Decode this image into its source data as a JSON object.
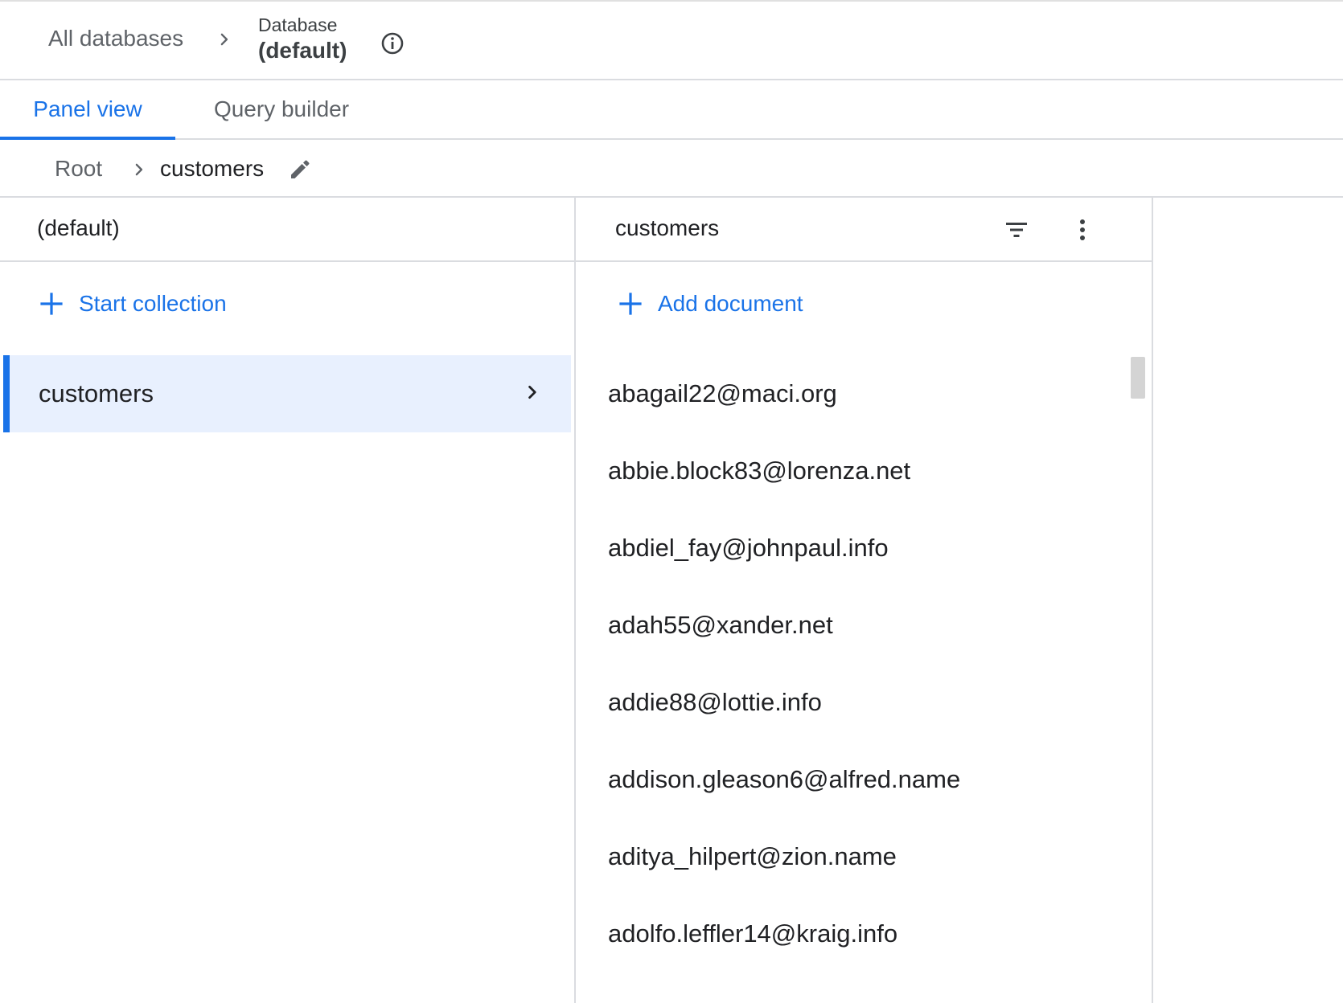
{
  "header": {
    "all_databases": "All databases",
    "database_label": "Database",
    "database_name": "(default)"
  },
  "tabs": [
    {
      "label": "Panel view",
      "active": true
    },
    {
      "label": "Query builder",
      "active": false
    }
  ],
  "path": {
    "root": "Root",
    "current": "customers"
  },
  "left_panel": {
    "title": "(default)",
    "action_label": "Start collection",
    "collections": [
      "customers"
    ]
  },
  "right_panel": {
    "title": "customers",
    "action_label": "Add document",
    "documents": [
      "abagail22@maci.org",
      "abbie.block83@lorenza.net",
      "abdiel_fay@johnpaul.info",
      "adah55@xander.net",
      "addie88@lottie.info",
      "addison.gleason6@alfred.name",
      "aditya_hilpert@zion.name",
      "adolfo.leffler14@kraig.info"
    ]
  },
  "icons": {
    "breadcrumb_separator": "chevron-right-icon",
    "info": "info-icon",
    "edit": "pencil-icon",
    "filter": "filter-icon",
    "more": "more-vert-icon",
    "add": "plus-icon"
  },
  "colors": {
    "accent": "#1a73e8",
    "selected_bg": "#e8f0fe",
    "border": "#dadce0",
    "muted_text": "#5f6368"
  }
}
